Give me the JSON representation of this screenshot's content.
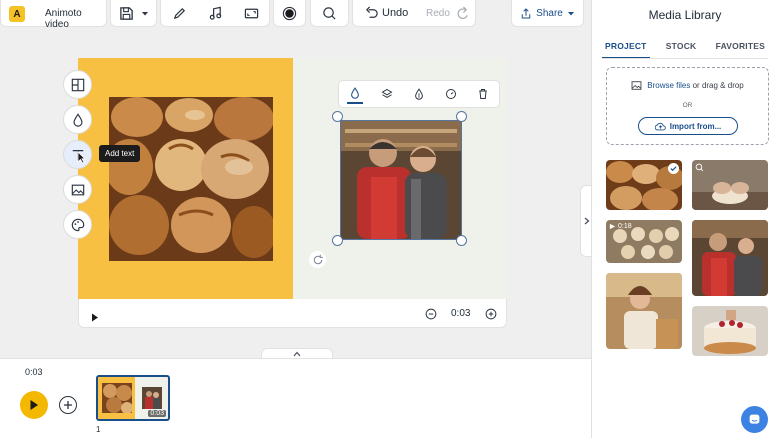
{
  "toolbar": {
    "app_name": "Animoto video",
    "undo_label": "Undo",
    "redo_label": "Redo",
    "share_label": "Share"
  },
  "panel": {
    "title": "Media Library",
    "tabs": [
      {
        "label": "PROJECT",
        "active": true
      },
      {
        "label": "STOCK",
        "active": false
      },
      {
        "label": "FAVORITES",
        "active": false
      }
    ],
    "browse_link": "Browse files",
    "drag_text": "or drag & drop",
    "or_text": "OR",
    "import_label": "Import from...",
    "media": [
      {
        "kind": "image",
        "subject": "bread pastries"
      },
      {
        "kind": "image",
        "subject": "kneading dough"
      },
      {
        "kind": "video",
        "duration": "0:18",
        "subject": "dough balls"
      },
      {
        "kind": "image",
        "subject": "bakers portrait"
      },
      {
        "kind": "image",
        "subject": "smiling baker woman"
      },
      {
        "kind": "image",
        "subject": "decorating cake"
      }
    ]
  },
  "editor": {
    "tooltip": "Add text",
    "duration": "0:03",
    "side_tools": [
      "layout-icon",
      "color-drop-icon",
      "text-icon",
      "image-icon",
      "palette-icon"
    ],
    "float_tools": [
      "color-drop-icon",
      "layers-icon",
      "effects-icon",
      "timing-icon",
      "trash-icon"
    ]
  },
  "timeline": {
    "current_time": "0:03",
    "scene_duration": "0:03",
    "scene_number": "1"
  },
  "colors": {
    "accent": "#1a4e8a",
    "brand_yellow": "#f5c226",
    "canvas_yellow": "#f7c043",
    "play_button": "#f5b800",
    "chat_button": "#3c82e3"
  }
}
